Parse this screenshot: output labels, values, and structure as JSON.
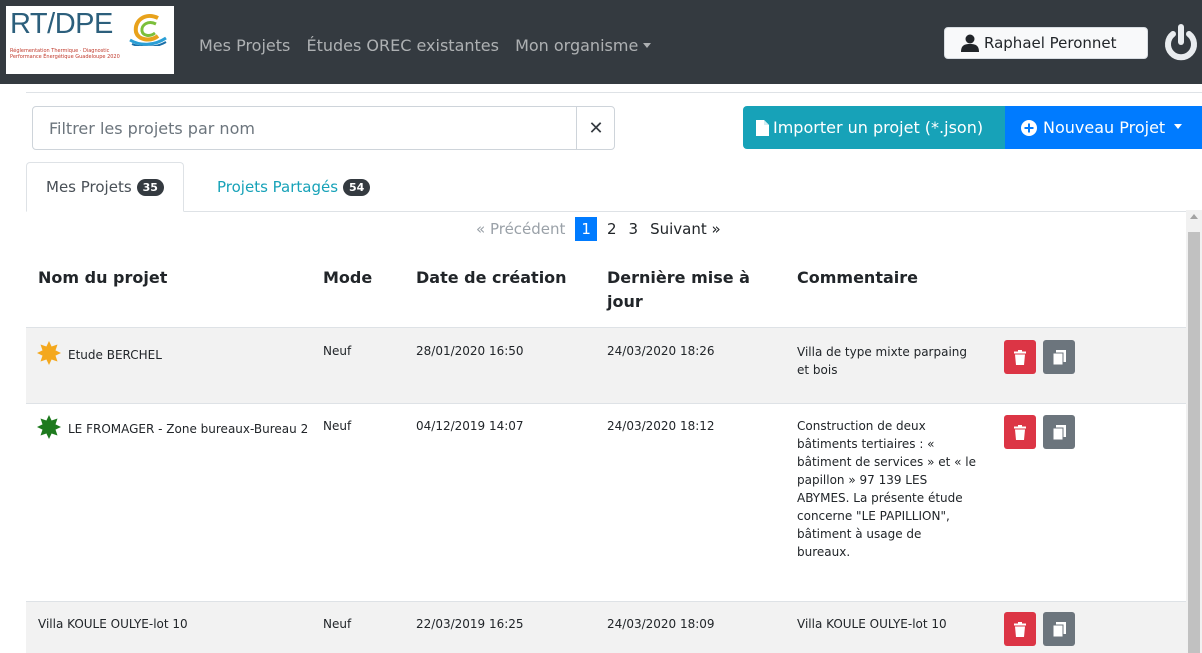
{
  "navbar": {
    "logo_text": "RT/DPE",
    "logo_subtext": "Réglementation Thermique · Diagnostic Performance Énergétique Guadeloupe 2020",
    "links": [
      "Mes Projets",
      "Études OREC existantes",
      "Mon organisme"
    ],
    "user_name": "Raphael Peronnet"
  },
  "toolbar": {
    "filter_placeholder": "Filtrer les projets par nom",
    "clear_label": "✕",
    "import_label": "Importer un projet (*.json)",
    "new_label": "Nouveau Projet"
  },
  "tabs": [
    {
      "label": "Mes Projets",
      "count": "35"
    },
    {
      "label": "Projets Partagés",
      "count": "54"
    }
  ],
  "pagination": {
    "prev": "« Précédent",
    "pages": [
      "1",
      "2",
      "3"
    ],
    "next": "Suivant »"
  },
  "table": {
    "headers": [
      "Nom du projet",
      "Mode",
      "Date de création",
      "Dernière mise à jour",
      "Commentaire"
    ],
    "rows": [
      {
        "name": "Etude BERCHEL",
        "mode": "Neuf",
        "created": "28/01/2020 16:50",
        "updated": "24/03/2020 18:26",
        "comment": "Villa de type mixte parpaing et bois",
        "status_color": "#f4a81d"
      },
      {
        "name": "LE FROMAGER - Zone bureaux-Bureau 2",
        "mode": "Neuf",
        "created": "04/12/2019 14:07",
        "updated": "24/03/2020 18:12",
        "comment": "Construction de deux bâtiments tertiaires : « bâtiment de services » et « le papillon » 97 139 LES ABYMES. La présente étude concerne \"LE PAPILLION\", bâtiment à usage de bureaux.",
        "status_color": "#1e7a1e"
      },
      {
        "name": "Villa KOULE OULYE-lot 10",
        "mode": "Neuf",
        "created": "22/03/2019 16:25",
        "updated": "24/03/2020 18:09",
        "comment": "Villa KOULE OULYE-lot 10",
        "status_color": ""
      }
    ]
  },
  "colors": {
    "navbar": "#343a40",
    "info": "#17a2b8",
    "primary": "#007bff",
    "danger": "#dc3545",
    "secondary": "#6c757d"
  }
}
